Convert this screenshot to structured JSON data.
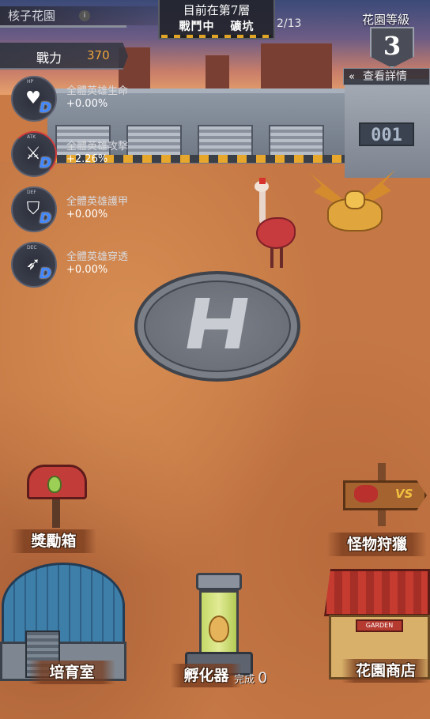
{
  "header": {
    "garden_name": "核子花園",
    "floor_title": "目前在第7層",
    "status_left": "戰鬥中",
    "status_right": "礦坑",
    "floor_progress": "2/13",
    "garden_level_label": "花園等級",
    "garden_level": "3",
    "details_button": "查看詳情",
    "details_icon": "chevron-left-icon"
  },
  "power": {
    "label": "戰力",
    "value": "370"
  },
  "buffs": [
    {
      "tag": "HP",
      "icon": "heart-icon",
      "name": "全體英雄生命",
      "value": "+0.00%"
    },
    {
      "tag": "ATK",
      "icon": "sword-icon",
      "name": "全體英雄攻擊",
      "value": "+2.26%"
    },
    {
      "tag": "DEF",
      "icon": "shield-icon",
      "name": "全體英雄護甲",
      "value": "+0.00%"
    },
    {
      "tag": "DEC",
      "icon": "spear-icon",
      "name": "全體英雄穿透",
      "value": "+0.00%"
    }
  ],
  "buildings": {
    "reward_box": "獎勵箱",
    "monster_hunt": "怪物狩獵",
    "nursery": "培育室",
    "incubator": "孵化器",
    "incubator_complete_label": "完成",
    "incubator_complete_count": "0",
    "garden_shop": "花園商店"
  },
  "scene": {
    "bunker_number": "001",
    "shop_sign": "GARDEN",
    "sign_vs": "VS"
  },
  "colors": {
    "power_value": "#f0a43a",
    "buff_badge": "#3f86ff",
    "ground": "#c57845"
  }
}
